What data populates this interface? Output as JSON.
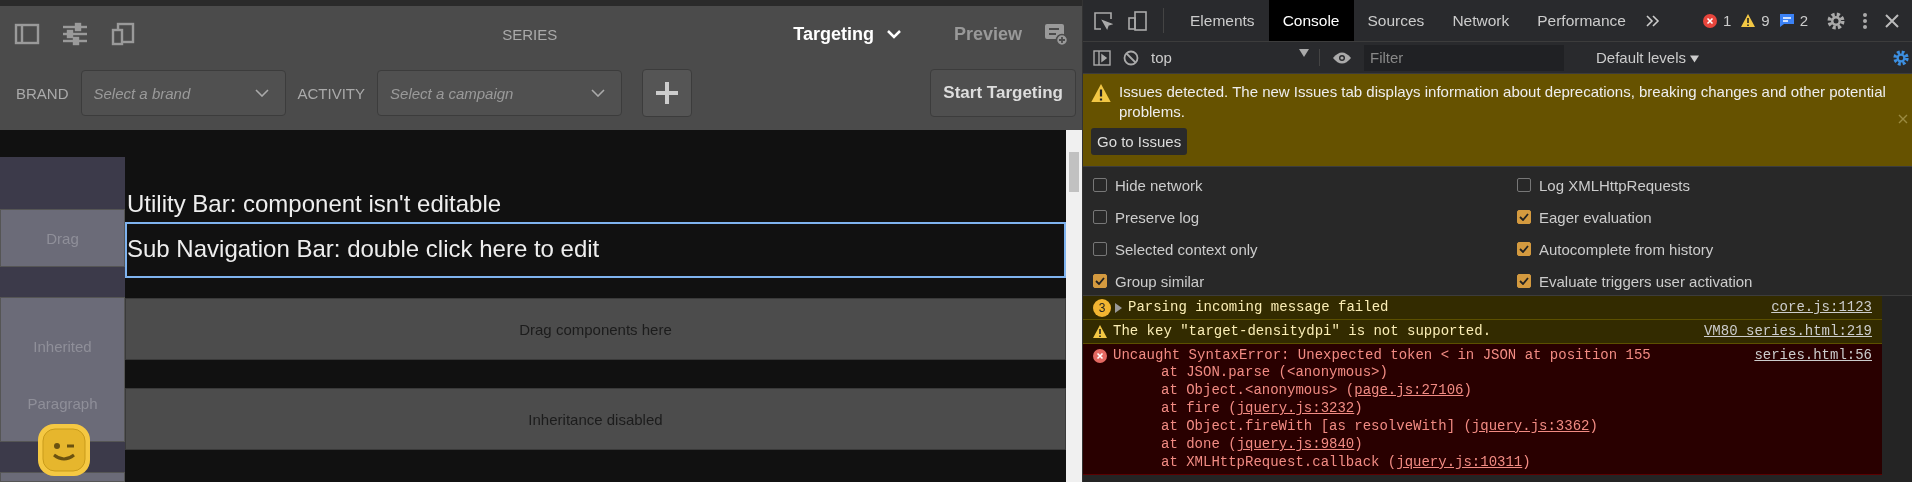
{
  "editor": {
    "title": "SERIES",
    "mode": "Targeting",
    "preview": "Preview",
    "filters": [
      {
        "label": "BRAND",
        "placeholder": "Select a brand"
      },
      {
        "label": "ACTIVITY",
        "placeholder": "Select a campaign"
      }
    ],
    "start_button": "Start Targeting",
    "sidebar": [
      "Drag",
      "Inherited",
      "Paragraph"
    ],
    "components": [
      {
        "text": "Utility Bar: component isn't editable",
        "selected": false
      },
      {
        "text": "Sub Navigation Bar: double click here to edit",
        "selected": true
      }
    ],
    "drop_zones": [
      "Drag components here",
      "Inheritance disabled"
    ]
  },
  "devtools": {
    "tabs": [
      {
        "label": "Elements",
        "selected": false
      },
      {
        "label": "Console",
        "selected": true
      },
      {
        "label": "Sources",
        "selected": false
      },
      {
        "label": "Network",
        "selected": false
      },
      {
        "label": "Performance",
        "selected": false
      }
    ],
    "counts": {
      "errors": "1",
      "warnings": "9",
      "info": "2"
    },
    "context": "top",
    "filter_placeholder": "Filter",
    "levels": "Default levels",
    "banner": {
      "text": "Issues detected. The new Issues tab displays information about deprecations, breaking changes and other potential problems.",
      "button": "Go to Issues"
    },
    "settings": [
      {
        "label": "Hide network",
        "checked": false
      },
      {
        "label": "Log XMLHttpRequests",
        "checked": false
      },
      {
        "label": "Preserve log",
        "checked": false
      },
      {
        "label": "Eager evaluation",
        "checked": true
      },
      {
        "label": "Selected context only",
        "checked": false
      },
      {
        "label": "Autocomplete from history",
        "checked": true
      },
      {
        "label": "Group similar",
        "checked": true
      },
      {
        "label": "Evaluate triggers user activation",
        "checked": true
      }
    ],
    "messages": [
      {
        "kind": "group",
        "count": "3",
        "text": "Parsing incoming message failed",
        "source": "core.js:1123"
      },
      {
        "kind": "warning",
        "text": "The key \"target-densitydpi\" is not supported.",
        "source": "VM80 series.html:219"
      },
      {
        "kind": "error",
        "text": "Uncaught SyntaxError: Unexpected token < in JSON at position 155",
        "source": "series.html:56",
        "stack": [
          {
            "text": "at JSON.parse (<anonymous>)"
          },
          {
            "text": "at Object.<anonymous> (",
            "link": "page.js:27106",
            "after": ")"
          },
          {
            "text": "at fire (",
            "link": "jquery.js:3232",
            "after": ")"
          },
          {
            "text": "at Object.fireWith [as resolveWith] (",
            "link": "jquery.js:3362",
            "after": ")"
          },
          {
            "text": "at done (",
            "link": "jquery.js:9840",
            "after": ")"
          },
          {
            "text": "at XMLHttpRequest.callback (",
            "link": "jquery.js:10311",
            "after": ")"
          }
        ]
      }
    ]
  }
}
